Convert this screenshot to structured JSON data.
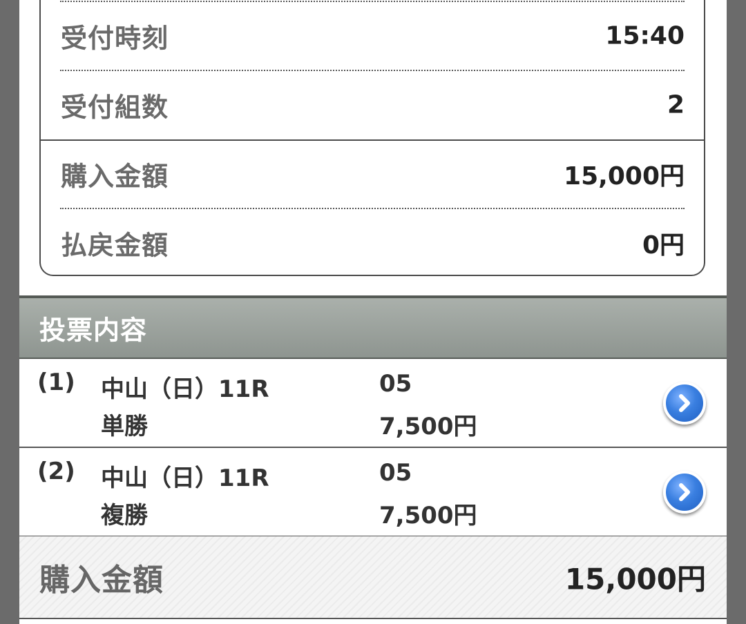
{
  "summary": {
    "rows": [
      {
        "label": "受付時刻",
        "value": "15:40"
      },
      {
        "label": "受付組数",
        "value": "2"
      },
      {
        "label": "購入金額",
        "value": "15,000円"
      },
      {
        "label": "払戻金額",
        "value": "0円"
      }
    ]
  },
  "bets_section": {
    "title": "投票内容",
    "items": [
      {
        "num": "(1)",
        "race": "中山（日）11R",
        "type": "単勝",
        "horse": "05",
        "amount": "7,500円",
        "icon": "chevron-right-icon"
      },
      {
        "num": "(2)",
        "race": "中山（日）11R",
        "type": "複勝",
        "horse": "05",
        "amount": "7,500円",
        "icon": "chevron-right-icon"
      }
    ]
  },
  "total": {
    "label": "購入金額",
    "value": "15,000円"
  },
  "colors": {
    "header_bg": "#9aa19c",
    "arrow_button": "#3a7fe0",
    "page_bg": "#ffffff",
    "backdrop": "#6b6b6b"
  }
}
